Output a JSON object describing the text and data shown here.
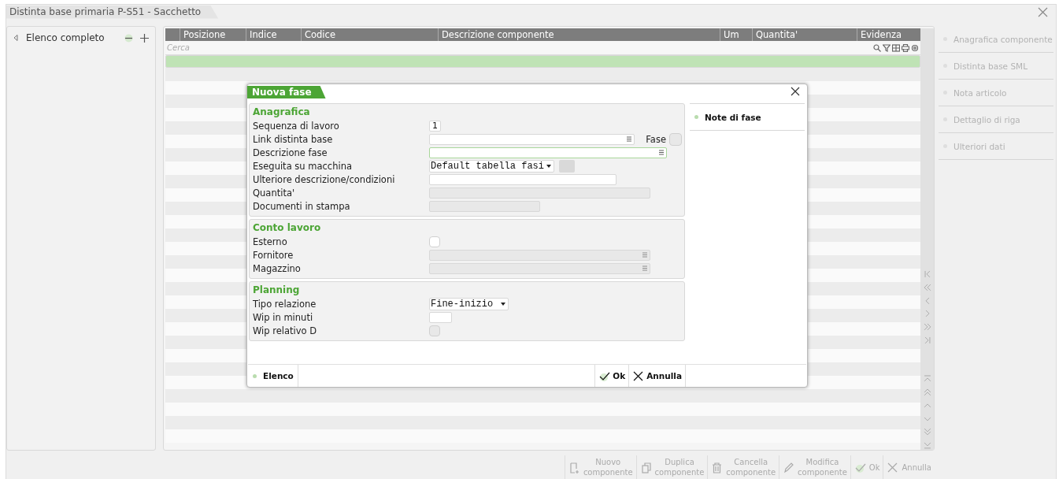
{
  "window": {
    "title": "Distinta base primaria P-S51 - Sacchetto"
  },
  "left_panel": {
    "title": "Elenco completo"
  },
  "table": {
    "columns": [
      "Posizione",
      "Indice",
      "Codice",
      "Descrizione componente",
      "Um",
      "Quantita'",
      "Evidenza"
    ],
    "search_placeholder": "Cerca",
    "rows": [
      {
        "selected": true
      },
      {
        "selected": false
      },
      {
        "selected": false
      },
      {
        "selected": false
      },
      {
        "selected": false
      },
      {
        "selected": false
      },
      {
        "selected": false
      },
      {
        "selected": false
      },
      {
        "selected": false
      },
      {
        "selected": false
      },
      {
        "selected": false
      },
      {
        "selected": false
      },
      {
        "selected": false
      },
      {
        "selected": false
      },
      {
        "selected": false
      },
      {
        "selected": false
      },
      {
        "selected": false
      },
      {
        "selected": false
      },
      {
        "selected": false
      },
      {
        "selected": false
      },
      {
        "selected": false
      },
      {
        "selected": false
      },
      {
        "selected": false
      },
      {
        "selected": false
      },
      {
        "selected": false
      },
      {
        "selected": false
      },
      {
        "selected": false
      },
      {
        "selected": false
      },
      {
        "selected": false
      }
    ]
  },
  "side_actions": [
    {
      "label": "Anagrafica componente",
      "disabled": true
    },
    {
      "label": "Distinta base SML",
      "disabled": true
    },
    {
      "label": "Nota articolo",
      "disabled": true
    },
    {
      "label": "Dettaglio di riga",
      "disabled": true
    },
    {
      "label": "Ulteriori dati",
      "disabled": true
    }
  ],
  "toolbar": [
    {
      "label": "Nuovo componente",
      "kind": "new",
      "disabled": true
    },
    {
      "label": "Duplica componente",
      "kind": "duplicate",
      "disabled": true
    },
    {
      "label": "Cancella componente",
      "kind": "delete",
      "disabled": true
    },
    {
      "label": "Modifica componente",
      "kind": "edit",
      "disabled": true
    },
    {
      "label": "Ok",
      "kind": "ok",
      "disabled": true
    },
    {
      "label": "Annulla",
      "kind": "cancel",
      "disabled": true
    }
  ],
  "dialog": {
    "title": "Nuova fase",
    "groups": [
      {
        "title": "Anagrafica",
        "fields": [
          {
            "label": "Sequenza di lavoro",
            "kind": "input",
            "value": "1",
            "disabled": false
          },
          {
            "label": "Link distinta base",
            "kind": "input",
            "lookup": true,
            "disabled": false,
            "extra": {
              "label": "Fase",
              "kind": "checkbox",
              "checked": false,
              "disabled": true
            }
          },
          {
            "label": "Descrizione fase",
            "kind": "input",
            "lookup": true,
            "focused": true,
            "disabled": false
          },
          {
            "label": "Eseguita su macchina",
            "kind": "select",
            "value": "Default tabella fasi",
            "disabled": false,
            "extra": {
              "kind": "button",
              "disabled": true
            }
          },
          {
            "label": "Ulteriore descrizione/condizioni",
            "kind": "input",
            "disabled": false
          },
          {
            "label": "Quantita'",
            "kind": "input",
            "disabled": true
          },
          {
            "label": "Documenti in stampa",
            "kind": "input",
            "disabled": true
          }
        ]
      },
      {
        "title": "Conto lavoro",
        "fields": [
          {
            "label": "Esterno",
            "kind": "checkbox",
            "checked": false,
            "disabled": false
          },
          {
            "label": "Fornitore",
            "kind": "input",
            "lookup": true,
            "disabled": true
          },
          {
            "label": "Magazzino",
            "kind": "input",
            "lookup": true,
            "disabled": true
          }
        ]
      },
      {
        "title": "Planning",
        "fields": [
          {
            "label": "Tipo relazione",
            "kind": "select",
            "value": "Fine-inizio ",
            "disabled": false
          },
          {
            "label": "Wip in minuti",
            "kind": "input",
            "disabled": false
          },
          {
            "label": "Wip relativo D",
            "kind": "checkbox",
            "checked": false,
            "disabled": true
          }
        ]
      }
    ],
    "side_links": [
      {
        "label": "Note di fase"
      }
    ],
    "footer_links": [
      {
        "label": "Elenco"
      }
    ],
    "buttons": [
      {
        "label": "Ok",
        "kind": "ok"
      },
      {
        "label": "Annulla",
        "kind": "cancel"
      }
    ]
  }
}
